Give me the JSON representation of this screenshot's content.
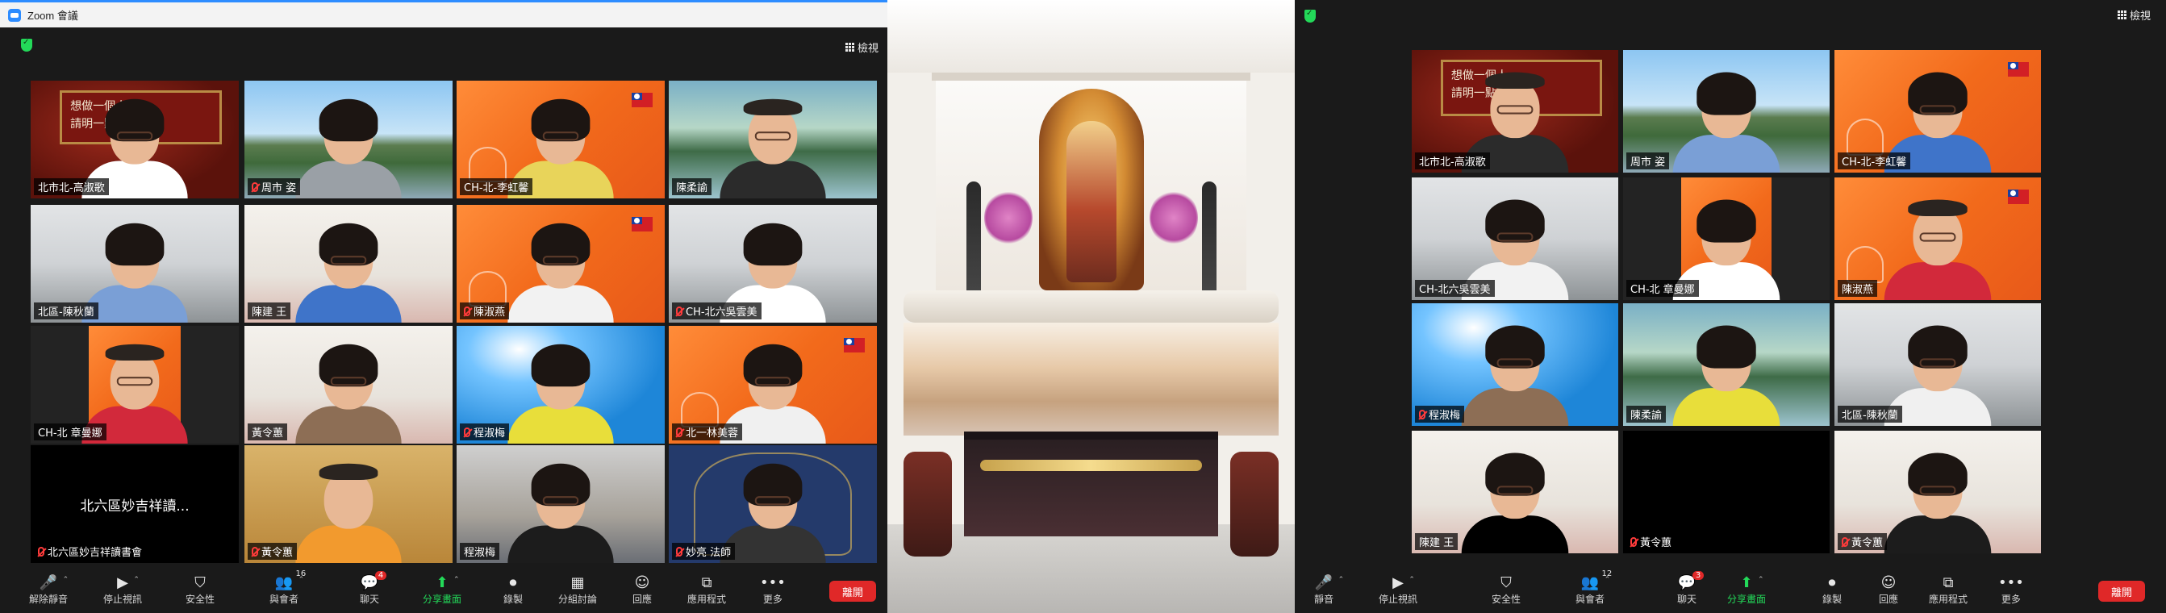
{
  "left_window": {
    "title": "Zoom 會議",
    "view_label": "檢視",
    "tiles": [
      {
        "name": "北市北-高淑歌",
        "bg": "red",
        "muted": false,
        "active": true,
        "board": "想做一個人\n請明一點裡"
      },
      {
        "name": "周市 姿",
        "bg": "lake",
        "muted": true
      },
      {
        "name": "CH-北-李虹馨",
        "bg": "orange",
        "muted": false
      },
      {
        "name": "陳柔諭",
        "bg": "water",
        "muted": false
      },
      {
        "name": "北區-陳秋蘭",
        "bg": "room",
        "muted": false
      },
      {
        "name": "陳建 王",
        "bg": "wall",
        "muted": false
      },
      {
        "name": "陳淑燕",
        "bg": "orange",
        "muted": true
      },
      {
        "name": "CH-北六吳雲美",
        "bg": "room",
        "muted": true
      },
      {
        "name": "CH-北 章曼娜",
        "bg": "orange-narrow",
        "muted": false
      },
      {
        "name": "黃令蕙",
        "bg": "wall",
        "muted": false
      },
      {
        "name": "程淑梅",
        "bg": "sky",
        "muted": true
      },
      {
        "name": "北一林美蓉",
        "bg": "orange",
        "muted": true
      },
      {
        "name": "北六區妙吉祥讀書會",
        "bg": "black",
        "muted": true,
        "center_text": "北六區妙吉祥讀..."
      },
      {
        "name": "黃令蕙",
        "bg": "gold",
        "muted": true
      },
      {
        "name": "程淑梅",
        "bg": "shelf",
        "muted": false
      },
      {
        "name": "妙亮 法師",
        "bg": "navy",
        "muted": true
      }
    ],
    "toolbar": {
      "mute": "解除靜音",
      "video": "停止視訊",
      "security": "安全性",
      "participants": "與會者",
      "participants_count": "16",
      "chat": "聊天",
      "chat_badge": "4",
      "share": "分享畫面",
      "record": "錄製",
      "breakout": "分組討論",
      "reactions": "回應",
      "apps": "應用程式",
      "more": "更多",
      "end": "離開"
    }
  },
  "right_window": {
    "view_label": "檢視",
    "tiles": [
      {
        "name": "北市北-高淑歌",
        "bg": "red",
        "muted": false,
        "board": "想做一個人\n請明一點裡"
      },
      {
        "name": "周市 姿",
        "bg": "lake",
        "muted": false,
        "active": true
      },
      {
        "name": "CH-北-李虹馨",
        "bg": "orange",
        "muted": false
      },
      {
        "name": "CH-北六吳雲美",
        "bg": "room",
        "muted": false
      },
      {
        "name": "CH-北 章曼娜",
        "bg": "orange-narrow",
        "muted": false
      },
      {
        "name": "陳淑燕",
        "bg": "orange",
        "muted": false
      },
      {
        "name": "程淑梅",
        "bg": "sky",
        "muted": true
      },
      {
        "name": "陳柔諭",
        "bg": "water",
        "muted": false
      },
      {
        "name": "北區-陳秋蘭",
        "bg": "room",
        "muted": false
      },
      {
        "name": "陳建 王",
        "bg": "wall",
        "muted": false
      },
      {
        "name": "黃令蕙",
        "bg": "black",
        "muted": true
      },
      {
        "name": "黃令蕙",
        "bg": "wall",
        "muted": true
      }
    ],
    "toolbar": {
      "mute": "靜音",
      "video": "停止視訊",
      "security": "安全性",
      "participants": "與會者",
      "participants_count": "12",
      "chat": "聊天",
      "chat_badge": "3",
      "share": "分享畫面",
      "record": "錄製",
      "reactions": "回應",
      "apps": "應用程式",
      "more": "更多",
      "end": "離開"
    }
  },
  "colors": {
    "zoom_blue": "#2d8cff",
    "active_speaker": "#e3e56a",
    "share_green": "#23d959",
    "end_red": "#e02828"
  }
}
